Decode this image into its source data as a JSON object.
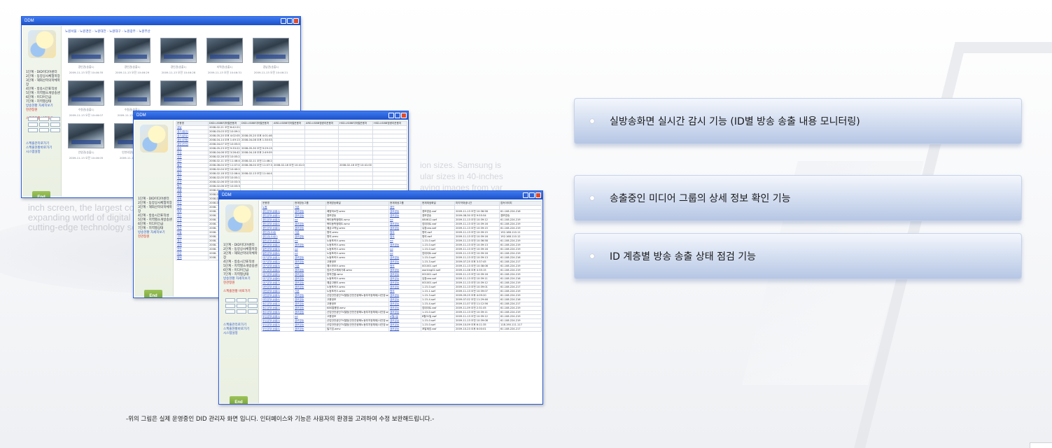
{
  "background_text": {
    "left_lines": [
      "inch screen, the largest com",
      "expanding world of digital b",
      "cutting-edge technology set"
    ],
    "right_lines": [
      "ion sizes. Samsung is",
      "ular sizes in 40-inches",
      "aying images from var"
    ]
  },
  "window_title": "DDM",
  "window1": {
    "breadcrumb": "노원서울 - 노원경인 - 노원대전 - 노원대구 - 노원광주 - 노원부산",
    "side_lines": [
      "1단계 - DID미디어센터",
      "2단계 - 동양상사체험학장",
      "3단계 - 해외산학의학체학장",
      "4단계 - 방송시간표작성",
      "5단계 - 지역별소개방송센",
      "6단계 - 미디어긴급",
      "7단계 - 지역별상태"
    ],
    "side_links": [
      "방송현황 자세히보기",
      "현관창원"
    ],
    "side_footer": [
      "스케줄현황 바로가기"
    ],
    "side_legend": [
      "스케줄관리로가기",
      "스케줄현황바로가기",
      "시스템설정"
    ],
    "end_label": "End",
    "thumbs_row1": [
      {
        "cap1": "경인권(송출1)",
        "cap2": "2009-11-13 오전 10:46:35"
      },
      {
        "cap1": "경인권(송출1)",
        "cap2": "2009-11-13 오전 10:46:29"
      },
      {
        "cap1": "경인권(송출1)",
        "cap2": "2009-11-13 오전 10:46:28"
      },
      {
        "cap1": "지역권(송출1)",
        "cap2": "2009-11-13 오전 10:46:31"
      },
      {
        "cap1": "경남권(송출1)",
        "cap2": "2009-11-13 오전 10:46:21"
      }
    ],
    "thumbs_row2": [
      {
        "cap1": "수원권(송출1)",
        "cap2": "2009-11-13 오전 10:46:07"
      },
      {
        "cap1": "수원권(송출1)",
        "cap2": "2009-11-13 오전 10:46"
      }
    ],
    "thumbs_row3": [
      {
        "cap1": "안양권(송출1)",
        "cap2": "2009-11-13 오전 10:46:05"
      },
      {
        "cap1": "인천의정부(송출1)",
        "cap2": "2009-11-13 오전 10"
      }
    ]
  },
  "window2": {
    "headers": [
      "운용명",
      "DSD-UGBB지하철운용처",
      "DSD-UGBB지하철운용처",
      "ARD-UGBB지하철운용처",
      "ARD-UGBB청량리운용처",
      "HSD-UGBB지하철운용처",
      "HSD-UGBB청량리운용처"
    ],
    "rows": [
      [
        "강남",
        "2008-02-21 오전 8:42:21",
        "",
        "",
        "",
        "",
        ""
      ],
      [
        "경기(일산)",
        "2008-03-03 오전 10:09:19",
        "",
        "",
        "",
        "",
        ""
      ],
      [
        "경기(분당)",
        "2008-05-20 오후 4:02:05",
        "2008-05-20 오후 4:01:46",
        "",
        "",
        "",
        ""
      ],
      [
        "경인(부평)",
        "2008-04-14 오후 1:49:13",
        "2008-04-08 오후 1:30:53",
        "",
        "",
        "",
        ""
      ],
      [
        "경인(인천)",
        "2008-04-07 오전 10:05:00",
        "",
        "",
        "",
        "",
        ""
      ],
      [
        "광주",
        "2008-05-23 오전 9:33:22",
        "2008-05-30 오전 9:29:13",
        "",
        "",
        "",
        ""
      ],
      [
        "부산",
        "2008-04-08 오전 3:26:42",
        "2008-04-18 오후 2:49:59",
        "",
        "",
        "",
        ""
      ],
      [
        "대전",
        "2008-02-26 오전 10:05:23",
        "",
        "",
        "",
        "",
        ""
      ],
      [
        "대구",
        "2008-02-11 오전 11:46:40",
        "2008-02-11 오전 11:46:27",
        "",
        "",
        "",
        ""
      ],
      [
        "울산",
        "2008-06-04 오전 11:07:47",
        "2008-06-04 오전 11:07:34",
        "2008-02-18 오전 10:41:00",
        "",
        "2008-02-18 오전 10:41:00",
        ""
      ],
      [
        "전주",
        "2008-02-04 오전 10:40:23",
        "",
        "",
        "",
        "",
        ""
      ],
      [
        "청주",
        "2008-02-18 오전 12:06:44",
        "2008-02-13 오전 11:44:42",
        "",
        "",
        "",
        ""
      ],
      [
        "제주",
        "2008-02-05 오전 10:05:13",
        "",
        "",
        "",
        "",
        ""
      ],
      [
        "춘천",
        "2008-02-06 오전 10:03:36",
        "",
        "",
        "",
        "",
        ""
      ],
      [
        "원주",
        "2008-02-06 오전 10:03:36",
        "",
        "",
        "",
        "",
        ""
      ],
      [
        "강릉",
        "2008-02-06",
        "",
        "",
        "",
        "",
        ""
      ],
      [
        "포항",
        "2008-02-",
        "",
        "",
        "",
        "",
        ""
      ],
      [
        "창원",
        "2008-0",
        "",
        "",
        "",
        "",
        ""
      ],
      [
        "마산",
        "2008-0",
        "",
        "",
        "",
        "",
        ""
      ],
      [
        "진주",
        "2008-",
        "",
        "",
        "",
        "",
        ""
      ],
      [
        "목포",
        "2008-",
        "",
        "",
        "",
        "",
        ""
      ],
      [
        "여수",
        "2008-",
        "",
        "",
        "",
        "",
        ""
      ],
      [
        "순천",
        "2008-",
        "",
        "",
        "",
        "",
        ""
      ],
      [
        "군산",
        "2008-",
        "",
        "",
        "",
        "",
        ""
      ],
      [
        "익산",
        "2008-",
        "",
        "",
        "",
        "",
        ""
      ],
      [
        "안동",
        "2008-",
        "",
        "",
        "",
        "",
        ""
      ],
      [
        "구미",
        "2008-",
        "",
        "",
        "",
        "",
        ""
      ],
      [
        "경주",
        "2008-",
        "",
        "",
        "",
        "",
        ""
      ],
      [
        "김해",
        "2008-",
        "",
        "",
        "",
        "",
        ""
      ],
      [
        "천안",
        "2008-",
        "",
        "",
        "",
        "",
        ""
      ],
      [
        "아산",
        "2008-",
        "",
        "",
        "",
        "",
        ""
      ],
      [
        "평택",
        "2008-",
        "",
        "",
        "",
        "",
        ""
      ]
    ],
    "side_lines": [
      "1단계 - DID미디어센터",
      "2단계 - 동양상사체험학장",
      "3단계 - 해외산학의학체학장",
      "4단계 - 방송시간표작성",
      "5단계 - 지역별소개방송센",
      "6단계 - 미디어긴급",
      "7단계 - 지역별상태"
    ],
    "side_links": [
      "방송현황 자세히보기",
      "현관창원"
    ],
    "end_label": "End"
  },
  "window3": {
    "headers": [
      "운용명",
      "현재방송그룹",
      "현재방송화일",
      "현재재생그룹",
      "현재재생화일",
      "마지막재생시간",
      "접속아이피"
    ],
    "rows": [
      [
        "노원",
        "기본",
        "",
        "경인",
        "",
        "",
        ""
      ],
      [
        "경인본부(송출1)",
        "경보방송",
        "쾌청하소먼.wmv",
        "경보방송",
        "경보방송.swf",
        "2009-11-13 오전 10:36:58",
        "61.108.224.216"
      ],
      [
        "경인본부(송출2)",
        "경보방송",
        "경보방송",
        "경보방송",
        "경보방송",
        "2009-08-30 오전 9:55:54",
        "경보방송"
      ],
      [
        "경인본부(송출3)",
        "nd",
        "북미동학정예도.wmv",
        "nd",
        "080612.swf",
        "2009-11-13 오전 10:39:12",
        "61.108.224.219"
      ],
      [
        "경인본부(송출4)",
        "경보방송",
        "북미동학정예도.wmv",
        "경보방송",
        "업데이트.swf",
        "2009-11-13 오전 10:39:16",
        "61.108.224.219"
      ],
      [
        "경인본부(송출5)",
        "경보방송",
        "예금고객님.wmv",
        "경보방송",
        "유창ceo.swf",
        "2009-11-13 오전 10:39:15",
        "61.108.224.219"
      ],
      [
        "경인권(사내)",
        "기본",
        "명의.wmv",
        "명의",
        "명의.swf",
        "2009-11-13 오전 10:39:15",
        "192.168.110.11"
      ],
      [
        "경인권(사내2)",
        "경보방송",
        "명의.wmv",
        "명의",
        "명의.swf",
        "2009-11-13 오전 10:39:16",
        "192.168.110.12"
      ],
      [
        "일반본부(송출1)",
        "nd",
        "노동포커스.wmv",
        "nd",
        "1-15-0.swf",
        "2009-11-13 오전 10:36:58",
        "61.108.224.219"
      ],
      [
        "일반본부(송출2)",
        "경보방송",
        "노동포커스.wmv",
        "경보방송",
        "1-15-0.swf",
        "2009-11-13 오전 10:39:13",
        "61.108.224.219"
      ],
      [
        "일반본부(송출3)",
        "nd",
        "노동포커스.wmv",
        "nd",
        "1-15-0.swf",
        "2009-11-13 오전 10:39:16",
        "61.108.224.219"
      ],
      [
        "일반본부(송출4)",
        "nd",
        "노동포커스.wmv",
        "nd",
        "업데이트.swf",
        "2009-11-13 오전 10:39:16",
        "61.108.224.219"
      ],
      [
        "대구본부(송출1)",
        "경보방송",
        "노동포커스.wmv",
        "경보방송",
        "1-15-0.swf",
        "2009-11-13 오전 10:39:13",
        "61.108.224.216"
      ],
      [
        "대구본부(송출2)",
        "경보방송",
        "고용정보",
        "경보방송",
        "1-15-3.swf",
        "2009-07-25 오후 3:37:45",
        "61.108.224.217"
      ],
      [
        "대구본부(송출3)",
        "기본",
        "예스모모스.wmv",
        "명의",
        "001001.swf",
        "2009-11-13 오전 10:38:08",
        "61.108.224.219"
      ],
      [
        "대구본부(송출4)",
        "경보방송",
        "업무연고체제기록.wmv",
        "경보방송",
        "working02.swf",
        "2009-11-08 오후 4:35:15",
        "61.108.224.219"
      ],
      [
        "대구본부(송출5)",
        "경보방송",
        "창작연출.wmv",
        "경보방송",
        "001001.swf",
        "2009-11-13 오전 10:39:16",
        "61.108.224.219"
      ],
      [
        "대구본부(송출6)",
        "경보방송",
        "노동포커스.wmv",
        "경보방송",
        "유창ceo.swf",
        "2009-11-13 오전 10:39:11",
        "61.108.224.216"
      ],
      [
        "대구본부(송출7)",
        "경보방송",
        "예금고용도.wmv",
        "경보방송",
        "001001.swf",
        "2009-11-13 오전 10:39:12",
        "61.108.224.219"
      ],
      [
        "대전본부(송출1)",
        "경보방송",
        "노동포커스.wmv",
        "경보방송",
        "1-15-0.swf",
        "2009-11-13 오전 10:39:01",
        "61.108.224.217"
      ],
      [
        "대전본부(송출2)",
        "기본",
        "노동포커스.wmv",
        "명의",
        "1-15-1.swf",
        "2009-11-13 오전 10:39:07",
        "61.108.224.219"
      ],
      [
        "대전본부(송출3)",
        "경보방송",
        "산업안전공단TV앨범(안전관광해노동부지정체제)사진영.wmv",
        "경보방송",
        "1-15-3.swf",
        "2009-09-25 오후 4:09:20",
        "61.108.224.219"
      ],
      [
        "대전본부(송출4)",
        "경보방송",
        "고용정보",
        "경보방송",
        "1-15-4.swf",
        "2009-07-02 오전 11:29:46",
        "61.108.224.216"
      ],
      [
        "광주본부(송출1)",
        "경보방송",
        "고용정보",
        "경보방송",
        "1-15-4.swf",
        "2009-11-07 오전 11:12:56",
        "61.108.224.217"
      ],
      [
        "광주본부(송출2)",
        "경보방송",
        "KBS열용정.wmv",
        "경보방송",
        "업데이트.swf",
        "2009-11-09 오전 2:31:05",
        "61.108.224.219"
      ],
      [
        "광주본부(송출3)",
        "경보방송",
        "산업안전공단TV앨범(안전관광해노동부지정체제)사진영.wmv",
        "경보방송",
        "1-15-0.swf",
        "2009-11-13 오전 10:39:11",
        "61.108.224.219"
      ],
      [
        "부산본부(송출1)",
        "nd",
        "고용정보",
        "#월1일",
        "8월31일.swf",
        "2009-11-13 오전 10:39:12",
        "61.108.224.219"
      ],
      [
        "부산본부(송출2)",
        "경보방송",
        "산업안전공단TV앨범(안전관광해노동부지정체제)사진영.wmv",
        "경보방송",
        "1-15-0.swf",
        "2009-11-13 오전 10:39:08",
        "61.108.224.219"
      ],
      [
        "부산본부(송출3)",
        "경보방송",
        "산업안전공단TV앨범(안전관광해노동부지정체제)사진영.wmv",
        "경보방송",
        "1-15-0.swf",
        "2009-10-09 오후 6:11:35",
        "118.190.111.117"
      ],
      [
        "부산본부(송출4)",
        "경보방송",
        "빌기업.wmv",
        "경보방송",
        "포알제업.swf",
        "2009-10-23 오후 6:00:01",
        "61.108.224.217"
      ]
    ],
    "side_lines": [
      "1단계 - DID미디어센터",
      "2단계 - 동양상사체험학장",
      "3단계 - 해외산학의학체학장",
      "4단계 - 방송시간표작성",
      "5단계 - 지역별소개방송센",
      "6단계 - 미디어긴급",
      "7단계 - 지역별상태"
    ],
    "side_links": [
      "방송현황 자세히보기",
      "현관창원"
    ],
    "side_footer": [
      "스케줄현황 바로가기"
    ],
    "side_legend": [
      "스케줄관리로가기",
      "스케줄현황바로가기",
      "시스템설정"
    ],
    "end_label": "End"
  },
  "features": [
    "실방송화면 실시간 감시 기능 (ID별 방송 송출 내용 모니터링)",
    "송출중인 미디어 그룹의 상세 정보 확인 기능",
    "ID 계층별 방송 송출 상태 점검 기능"
  ],
  "caption": "-위의 그림은 실제 운영중인 DID 관리자 화면 입니다. 인터페이스와 기능은 사용자의 환경을 고려하여 수정 보완해드립니다.-"
}
